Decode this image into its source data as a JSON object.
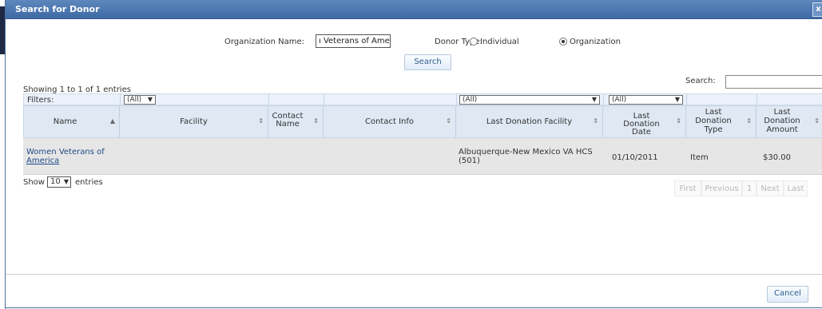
{
  "dialog": {
    "title": "Search for Donor",
    "close_label": "x"
  },
  "search_form": {
    "org_label": "Organization Name:",
    "org_value": "Veterans of Ameri",
    "donor_type_label": "Donor Type:",
    "individual_label": "Individual",
    "organization_label": "Organization",
    "selected_type": "Organization",
    "search_button": "Search"
  },
  "table_tools": {
    "info": "Showing 1 to 1 of 1 entries",
    "search_label": "Search:",
    "search_value": "",
    "filters_label": "Filters:",
    "filter_values": {
      "name": "(All)",
      "last_donation_facility": "(All)",
      "last_donation_date": "(All)"
    }
  },
  "columns": [
    {
      "label": "Name",
      "sort": "▲"
    },
    {
      "label": "Facility",
      "sort": "⇕"
    },
    {
      "label": "Contact Name",
      "sort": "⇕"
    },
    {
      "label": "Contact Info",
      "sort": "⇕"
    },
    {
      "label": "Last Donation Facility",
      "sort": "⇕"
    },
    {
      "label": "Last Donation Date",
      "sort": "⇕"
    },
    {
      "label": "Last Donation Type",
      "sort": "⇕"
    },
    {
      "label": "Last Donation Amount",
      "sort": "⇕"
    }
  ],
  "rows": [
    {
      "name_line1": "Women Veterans of",
      "name_line2": "America",
      "facility": "",
      "contact_name": "",
      "contact_info": "",
      "last_donation_facility_line1": "Albuquerque-New Mexico VA HCS",
      "last_donation_facility_line2": "(501)",
      "last_donation_date": "01/10/2011",
      "last_donation_type": "Item",
      "last_donation_amount": "$30.00"
    }
  ],
  "length_menu": {
    "show_label": "Show",
    "value": "10",
    "entries_label": "entries"
  },
  "pagination": {
    "first": "First",
    "previous": "Previous",
    "page": "1",
    "next": "Next",
    "last": "Last"
  },
  "footer": {
    "cancel_button": "Cancel"
  }
}
